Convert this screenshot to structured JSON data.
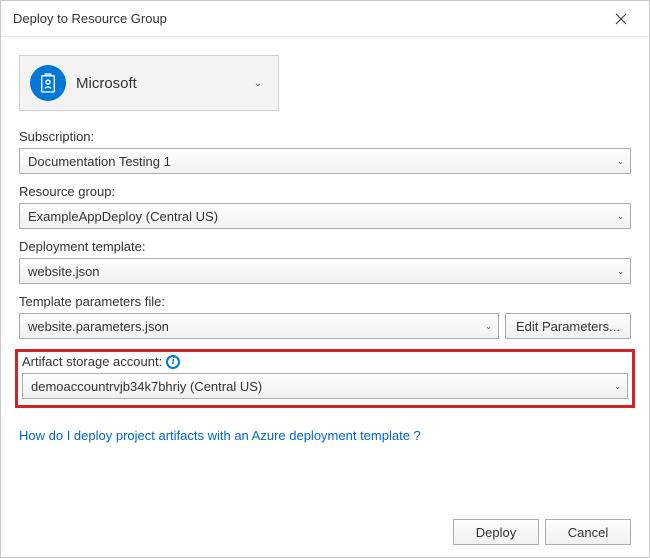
{
  "window": {
    "title": "Deploy to Resource Group"
  },
  "account": {
    "name": "Microsoft"
  },
  "subscription": {
    "label": "Subscription:",
    "value": "Documentation Testing 1"
  },
  "resourceGroup": {
    "label": "Resource group:",
    "value": "ExampleAppDeploy (Central US)"
  },
  "deploymentTemplate": {
    "label": "Deployment template:",
    "value": "website.json"
  },
  "templateParams": {
    "label": "Template parameters file:",
    "value": "website.parameters.json",
    "editBtn": "Edit Parameters..."
  },
  "artifactStorage": {
    "label": "Artifact storage account:",
    "value": "demoaccountrvjb34k7bhriy (Central US)"
  },
  "helpLink": "How do I deploy project artifacts with an Azure deployment template ?",
  "buttons": {
    "deploy": "Deploy",
    "cancel": "Cancel"
  }
}
